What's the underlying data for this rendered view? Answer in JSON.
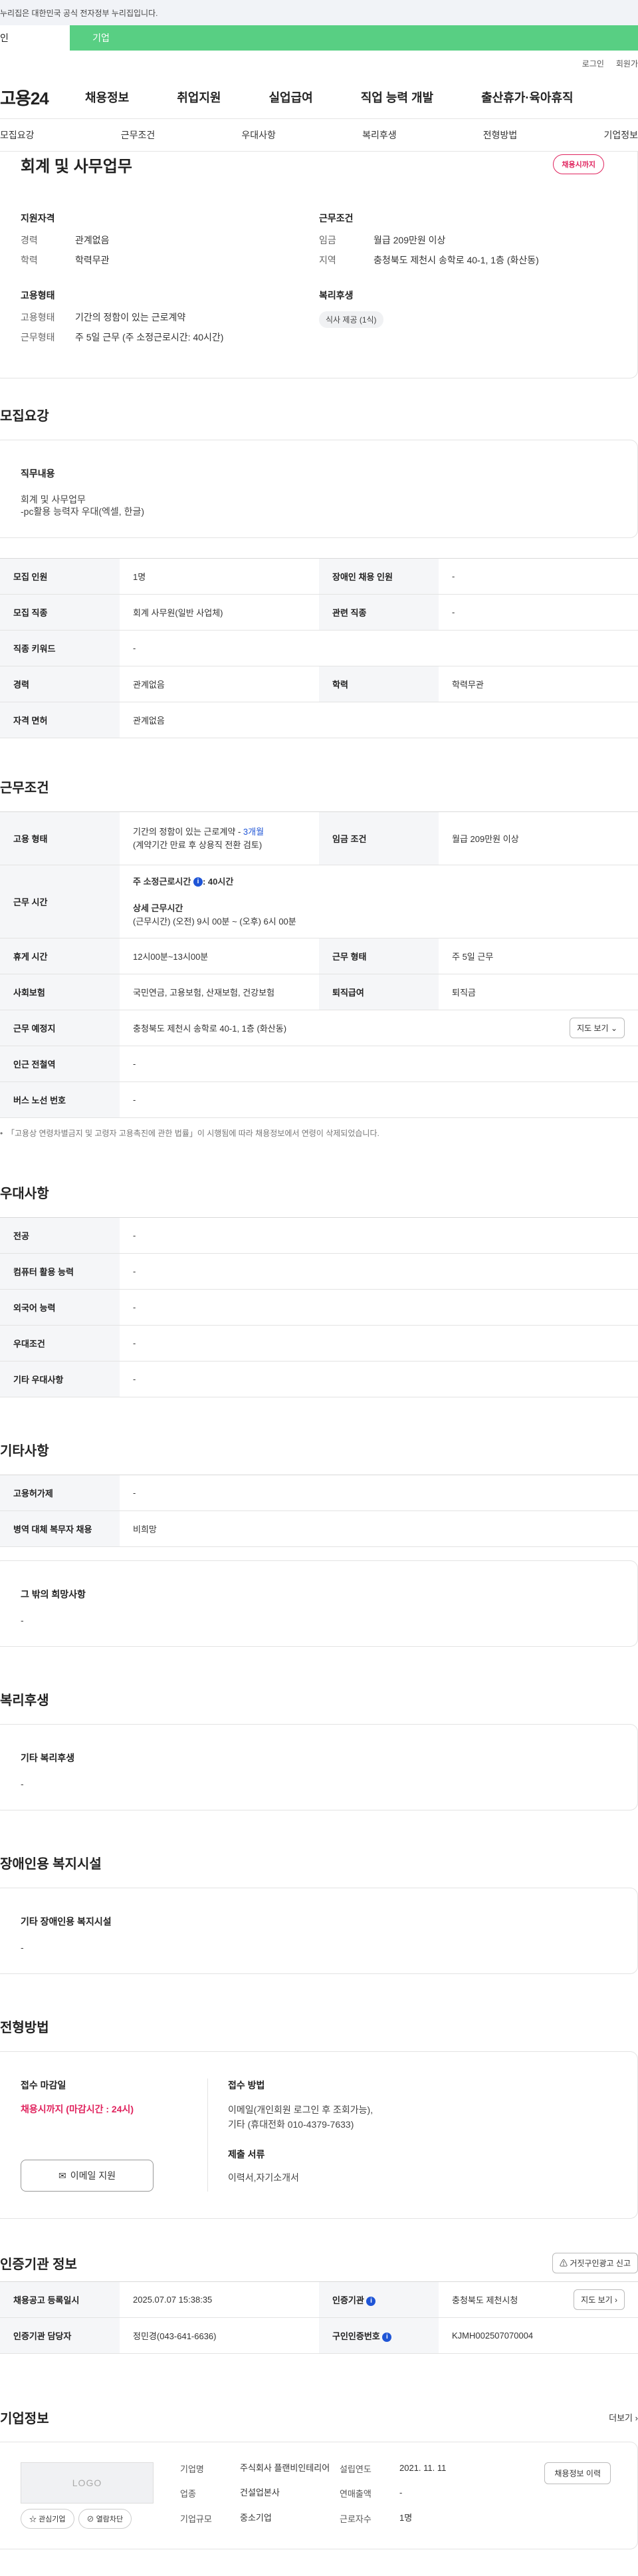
{
  "top": {
    "gov_notice": "누리집은 대한민국 공식 전자정부 누리집입니다.",
    "tab_individual": "인",
    "tab_business": "기업",
    "login": "로그인",
    "signup": "회원가"
  },
  "gnb": {
    "logo": "고용24",
    "items": [
      "채용정보",
      "취업지원",
      "실업급여",
      "직업 능력 개발",
      "출산휴가·육아휴직"
    ]
  },
  "subnav": [
    "모집요강",
    "근무조건",
    "우대사항",
    "복리후생",
    "전형방법",
    "기업정보"
  ],
  "summary": {
    "title": "회계 및 사무업무",
    "badge": "채용시까지",
    "qual_title": "지원자격",
    "career_k": "경력",
    "career_v": "관계없음",
    "edu_k": "학력",
    "edu_v": "학력무관",
    "emp_title": "고용형태",
    "emptype_k": "고용형태",
    "emptype_v": "기간의 정함이 있는 근로계약",
    "worktype_k": "근무형태",
    "worktype_v": "주 5일 근무 (주 소정근로시간: 40시간)",
    "cond_title": "근무조건",
    "wage_k": "임금",
    "wage_v": "월급 209만원 이상",
    "region_k": "지역",
    "region_v": "충청북도 제천시 송학로 40-1, 1층 (화산동)",
    "welfare_title": "복리후생",
    "welfare_chip": "식사 제공 (1식)"
  },
  "recruit": {
    "title": "모집요강",
    "duty_title": "직무내용",
    "duty_text": [
      "회계 및 사무업무",
      "-pc활용 능력자 우대(엑셀, 한글)"
    ],
    "rows": [
      [
        "모집 인원",
        "1명",
        "장애인 채용 인원",
        "-"
      ],
      [
        "모집 직종",
        "회계 사무원(일반 사업체)",
        "관련 직종",
        "-"
      ],
      [
        "직종 키워드",
        "-"
      ],
      [
        "경력",
        "관계없음",
        "학력",
        "학력무관"
      ],
      [
        "자격 면허",
        "관계없음"
      ]
    ]
  },
  "conditions": {
    "title": "근무조건",
    "emp_k": "고용 형태",
    "emp_v1": "기간의 정함이 있는 근로계약 - ",
    "emp_v1_blue": "3개월",
    "emp_v2": "(계약기간 만료 후 상용직 전환 검토)",
    "wage_k": "임금 조건",
    "wage_v": "월급 209만원 이상",
    "hours_k": "근무 시간",
    "hours_main": "주 소정근로시간",
    "hours_main_v": ": 40시간",
    "hours_detail_title": "상세 근무시간",
    "hours_detail": "(근무시간) (오전) 9시 00분 ~ (오후) 6시 00분",
    "break_k": "휴게 시간",
    "break_v": "12시00분~13시00분",
    "worktype_k": "근무 형태",
    "worktype_v": "주 5일 근무",
    "insurance_k": "사회보험",
    "insurance_v": "국민연금, 고용보험, 산재보험, 건강보험",
    "retire_k": "퇴직급여",
    "retire_v": "퇴직금",
    "place_k": "근무 예정지",
    "place_v": "충청북도 제천시 송학로 40-1, 1층 (화산동)",
    "map_btn": "지도 보기",
    "station_k": "인근 전철역",
    "station_v": "-",
    "bus_k": "버스 노선 번호",
    "bus_v": "-",
    "notice": "「고용상 연령차별금지 및 고령자 고용촉진에 관한 법률」이 시행됨에 따라 채용정보에서 연령이 삭제되었습니다."
  },
  "preference": {
    "title": "우대사항",
    "rows": [
      [
        "전공",
        "-"
      ],
      [
        "컴퓨터 활용 능력",
        "-"
      ],
      [
        "외국어 능력",
        "-"
      ],
      [
        "우대조건",
        "-"
      ],
      [
        "기타 우대사항",
        "-"
      ]
    ]
  },
  "other": {
    "title": "기타사항",
    "rows": [
      [
        "고용허가제",
        "-"
      ],
      [
        "병역 대체 복무자 채용",
        "비희망"
      ]
    ],
    "etc_title": "그 밖의 희망사항",
    "etc_v": "-"
  },
  "welfare": {
    "title": "복리후생",
    "box_title": "기타 복리후생",
    "box_v": "-"
  },
  "disabled": {
    "title": "장애인용 복지시설",
    "box_title": "기타 장애인용 복지시설",
    "box_v": "-"
  },
  "process": {
    "title": "전형방법",
    "deadline_title": "접수 마감일",
    "deadline_v": "채용시까지 (마감시간 : 24시)",
    "email_btn": "이메일 지원",
    "method_title": "접수 방법",
    "method_v1": "이메일(개인회원 로그인 후 조회가능),",
    "method_v2": "기타 (휴대전화 010-4379-7633)",
    "docs_title": "제출 서류",
    "docs_v": "이력서,자기소개서"
  },
  "agency": {
    "title": "인증기관 정보",
    "report_btn": "거짓구인광고 신고",
    "date_k": "채용공고 등록일시",
    "date_v": "2025.07.07 15:38:35",
    "org_k": "인증기관",
    "org_v": "충청북도 제천시청",
    "map_btn": "지도 보기",
    "mgr_k": "인증기관 담당자",
    "mgr_v": "정민경(043-641-6636)",
    "id_k": "구인인증번호",
    "id_v": "KJMH002507070004"
  },
  "company": {
    "title": "기업정보",
    "more": "더보기",
    "logo_text": "LOGO",
    "fav_btn": "관심기업",
    "block_btn": "열람차단",
    "name_k": "기업명",
    "name_v": "주식회사 플랜비인테리어",
    "founded_k": "설립연도",
    "founded_v": "2021. 11. 11",
    "industry_k": "업종",
    "industry_v": "건설업본사",
    "sales_k": "연매출액",
    "sales_v": "-",
    "size_k": "기업규모",
    "size_v": "중소기업",
    "workers_k": "근로자수",
    "workers_v": "1명",
    "history_btn": "채용정보 이력"
  }
}
